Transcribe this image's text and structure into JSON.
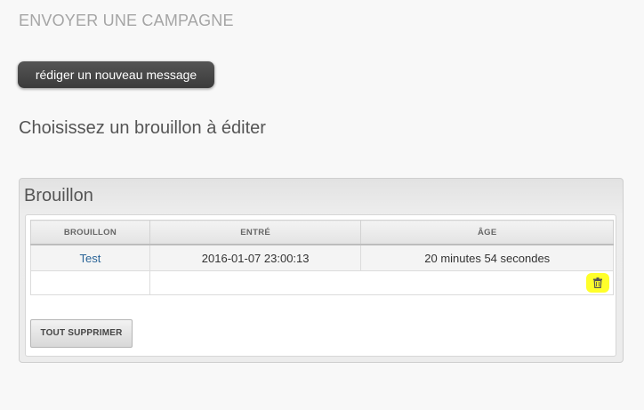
{
  "page": {
    "title": "ENVOYER UNE CAMPAGNE",
    "compose_button": "rédiger un nouveau message",
    "section_heading": "Choisissez un brouillon à éditer"
  },
  "panel": {
    "title": "Brouillon",
    "columns": [
      "BROUILLON",
      "ENTRÉ",
      "ÂGE"
    ],
    "rows": [
      {
        "name": "Test",
        "entered": "2016-01-07 23:00:13",
        "age": "20 minutes 54 secondes"
      }
    ],
    "delete_icon": "trash-icon",
    "delete_icon_highlight": "#ffff2a",
    "delete_all_button": "TOUT SUPPRIMER"
  },
  "colors": {
    "background": "#f8f8f8",
    "button_dark": "#444444",
    "link": "#2a6497",
    "muted_title": "#a5a5a5"
  }
}
